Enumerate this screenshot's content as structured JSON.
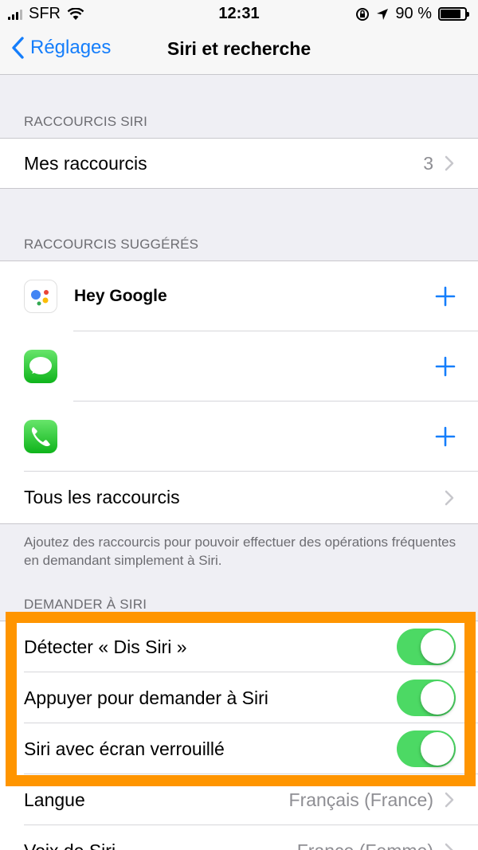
{
  "status_bar": {
    "carrier": "SFR",
    "time": "12:31",
    "battery": "90 %",
    "battery_level": 0.9
  },
  "nav": {
    "back_label": "Réglages",
    "title": "Siri et recherche"
  },
  "sections": {
    "shortcuts_header": "RACCOURCIS SIRI",
    "suggested_header": "RACCOURCIS SUGGÉRÉS",
    "ask_header": "DEMANDER À SIRI"
  },
  "my_shortcuts": {
    "label": "Mes raccourcis",
    "count": "3"
  },
  "suggested": [
    {
      "app": "Hey Google",
      "icon": "google-assistant-icon"
    },
    {
      "app": "",
      "icon": "messages-icon"
    },
    {
      "app": "",
      "icon": "phone-icon"
    }
  ],
  "all_shortcuts": {
    "label": "Tous les raccourcis"
  },
  "footer": "Ajoutez des raccourcis pour pouvoir effectuer des opérations fréquentes en demandant simplement à Siri.",
  "ask_siri": {
    "hey_siri": {
      "label": "Détecter « Dis Siri »",
      "on": true
    },
    "press_button": {
      "label": "Appuyer pour demander à Siri",
      "on": true
    },
    "locked": {
      "label": "Siri avec écran verrouillé",
      "on": true
    }
  },
  "language": {
    "label": "Langue",
    "value": "Français (France)"
  },
  "voice": {
    "label": "Voix de Siri",
    "value": "France (Femme)"
  },
  "colors": {
    "accent": "#157efb",
    "toggle_on": "#4cd964",
    "highlight": "#ff9500"
  }
}
